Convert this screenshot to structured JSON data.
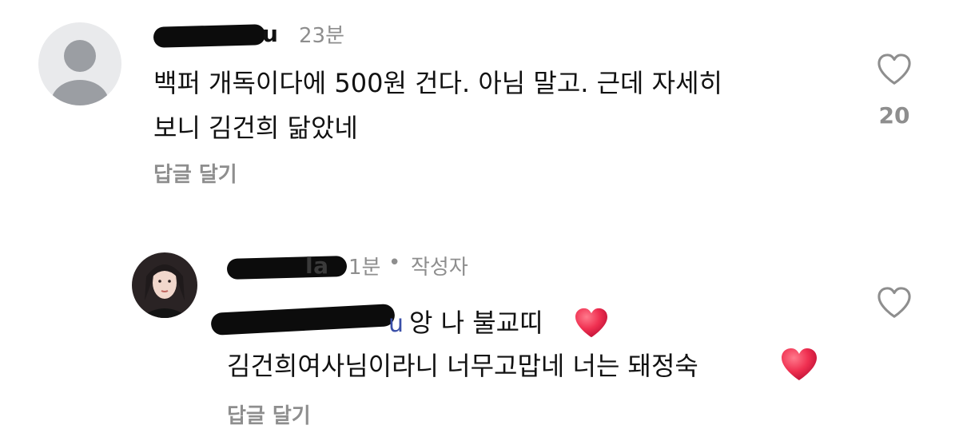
{
  "comments": [
    {
      "username_visible": "u",
      "time": "23분",
      "text": "백퍼 개독이다에 500원 건다. 아님 말고.  근데 자세히\n보니 김건희 닮았네",
      "reply_label": "답글 달기",
      "like_count": "20",
      "avatar_icon": "default-avatar-icon",
      "like_icon": "heart-outline-icon"
    },
    {
      "username_visible": "la",
      "time": "1분",
      "separator": "•",
      "author_badge": "작성자",
      "mention_visible": "u",
      "line1": "앙 나 불교띠",
      "line2": "김건희여사님이라니 너무고맙네 너는 돼정숙",
      "reply_label": "답글 달기",
      "avatar_icon": "profile-photo",
      "like_icon": "heart-outline-icon",
      "emoji_icon": "red-heart-emoji"
    }
  ],
  "colors": {
    "text": "#111111",
    "muted": "#8e8e8e",
    "mention": "#3a4fa8",
    "heart_emoji": "#e8274b",
    "avatar_bg": "#e9eaec",
    "avatar_fg": "#9b9ea3"
  }
}
